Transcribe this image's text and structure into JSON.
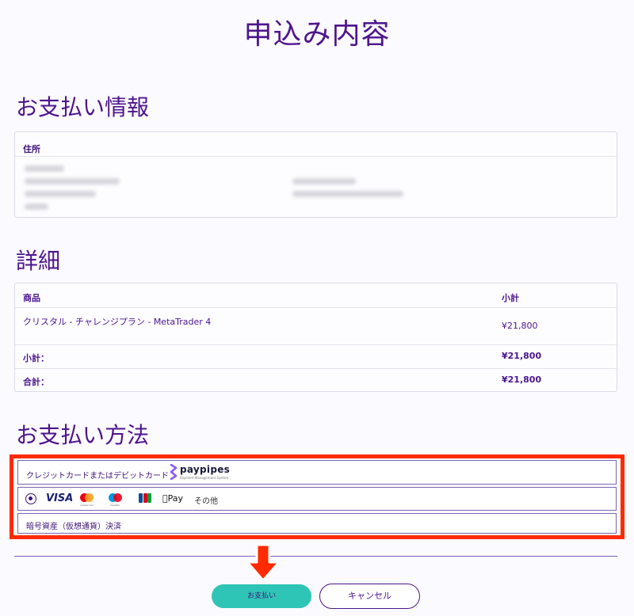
{
  "page": {
    "title": "申込み内容"
  },
  "billing": {
    "heading": "お支払い情報",
    "address_label": "住所"
  },
  "details": {
    "heading": "詳細",
    "columns": {
      "product": "商品",
      "subtotal": "小計"
    },
    "item": {
      "name": "クリスタル - チャレンジプラン - MetaTrader 4",
      "price": "¥21,800"
    },
    "subtotal": {
      "label": "小計：",
      "value": "¥21,800"
    },
    "total": {
      "label": "合計：",
      "value": "¥21,800"
    }
  },
  "payment": {
    "heading": "お支払い方法",
    "card_option_label": "クレジットカードまたはデビットカード",
    "provider": {
      "name": "paypipes",
      "tagline": "Payment Management System"
    },
    "brands": {
      "visa": "VISA",
      "mastercard": "mastercard",
      "maestro": "maestro",
      "applepay": "Pay",
      "other": "その他"
    },
    "crypto_option_label": "暗号資産（仮想通貨）決済",
    "colors": {
      "highlight": "#ff2a00",
      "mc_red": "#eb001b",
      "mc_orange": "#f79e1b",
      "maestro_blue": "#0099df"
    }
  },
  "actions": {
    "pay_label": "お支払い",
    "cancel_label": "キャンセル",
    "pay_color": "#2ec4b6"
  }
}
